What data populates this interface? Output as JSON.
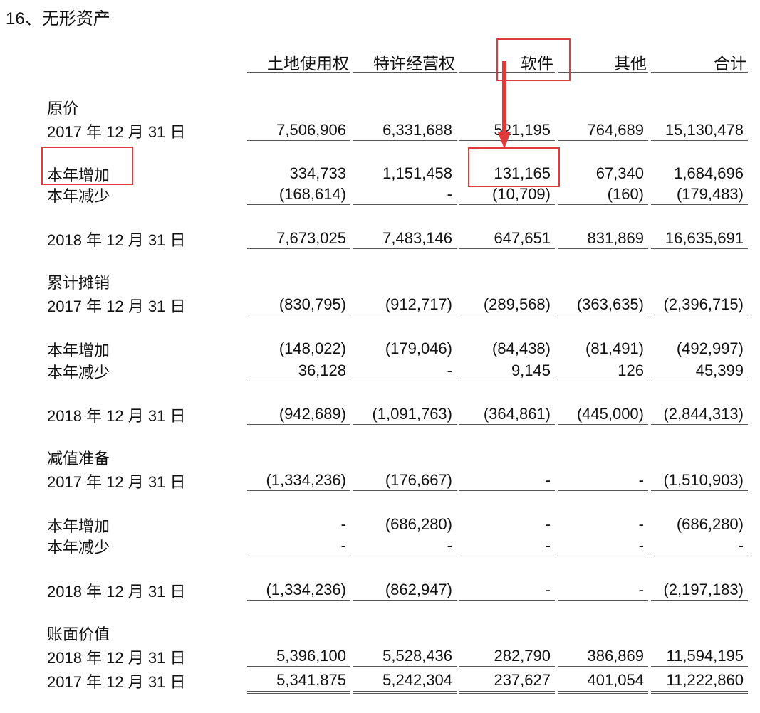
{
  "title": "16、无形资产",
  "columns": [
    "土地使用权",
    "特许经营权",
    "软件",
    "其他",
    "合计"
  ],
  "sections": [
    {
      "heading": "原价",
      "rows": [
        {
          "label": "2017 年 12 月 31 日",
          "values": [
            "7,506,906",
            "6,331,688",
            "521,195",
            "764,689",
            "15,130,478"
          ],
          "underline": "single"
        },
        {
          "label": "本年增加",
          "values": [
            "334,733",
            "1,151,458",
            "131,165",
            "67,340",
            "1,684,696"
          ]
        },
        {
          "label": "本年减少",
          "values": [
            "(168,614)",
            "-",
            "(10,709)",
            "(160)",
            "(179,483)"
          ],
          "underline": "single"
        },
        {
          "label": "2018 年 12 月 31 日",
          "values": [
            "7,673,025",
            "7,483,146",
            "647,651",
            "831,869",
            "16,635,691"
          ],
          "underline": "single"
        }
      ]
    },
    {
      "heading": "累计摊销",
      "rows": [
        {
          "label": "2017 年 12 月 31 日",
          "values": [
            "(830,795)",
            "(912,717)",
            "(289,568)",
            "(363,635)",
            "(2,396,715)"
          ],
          "underline": "single"
        },
        {
          "label": "本年增加",
          "values": [
            "(148,022)",
            "(179,046)",
            "(84,438)",
            "(81,491)",
            "(492,997)"
          ]
        },
        {
          "label": "本年减少",
          "values": [
            "36,128",
            "-",
            "9,145",
            "126",
            "45,399"
          ],
          "underline": "single"
        },
        {
          "label": "2018 年 12 月 31 日",
          "values": [
            "(942,689)",
            "(1,091,763)",
            "(364,861)",
            "(445,000)",
            "(2,844,313)"
          ],
          "underline": "single"
        }
      ]
    },
    {
      "heading": "减值准备",
      "rows": [
        {
          "label": "2017 年 12 月 31 日",
          "values": [
            "(1,334,236)",
            "(176,667)",
            "-",
            "-",
            "(1,510,903)"
          ],
          "underline": "single"
        },
        {
          "label": "本年增加",
          "values": [
            "-",
            "(686,280)",
            "-",
            "-",
            "(686,280)"
          ]
        },
        {
          "label": "本年减少",
          "values": [
            "-",
            "-",
            "-",
            "-",
            "-"
          ],
          "underline": "single"
        },
        {
          "label": "2018 年 12 月 31 日",
          "values": [
            "(1,334,236)",
            "(862,947)",
            "-",
            "-",
            "(2,197,183)"
          ],
          "underline": "single"
        }
      ]
    },
    {
      "heading": "账面价值",
      "rows": [
        {
          "label": "2018 年 12 月 31 日",
          "values": [
            "5,396,100",
            "5,528,436",
            "282,790",
            "386,869",
            "11,594,195"
          ],
          "underline": "single"
        },
        {
          "label": "2017 年 12 月 31 日",
          "values": [
            "5,341,875",
            "5,242,304",
            "237,627",
            "401,054",
            "11,222,860"
          ],
          "underline": "double"
        }
      ]
    }
  ],
  "highlight_color": "#e03a3a"
}
